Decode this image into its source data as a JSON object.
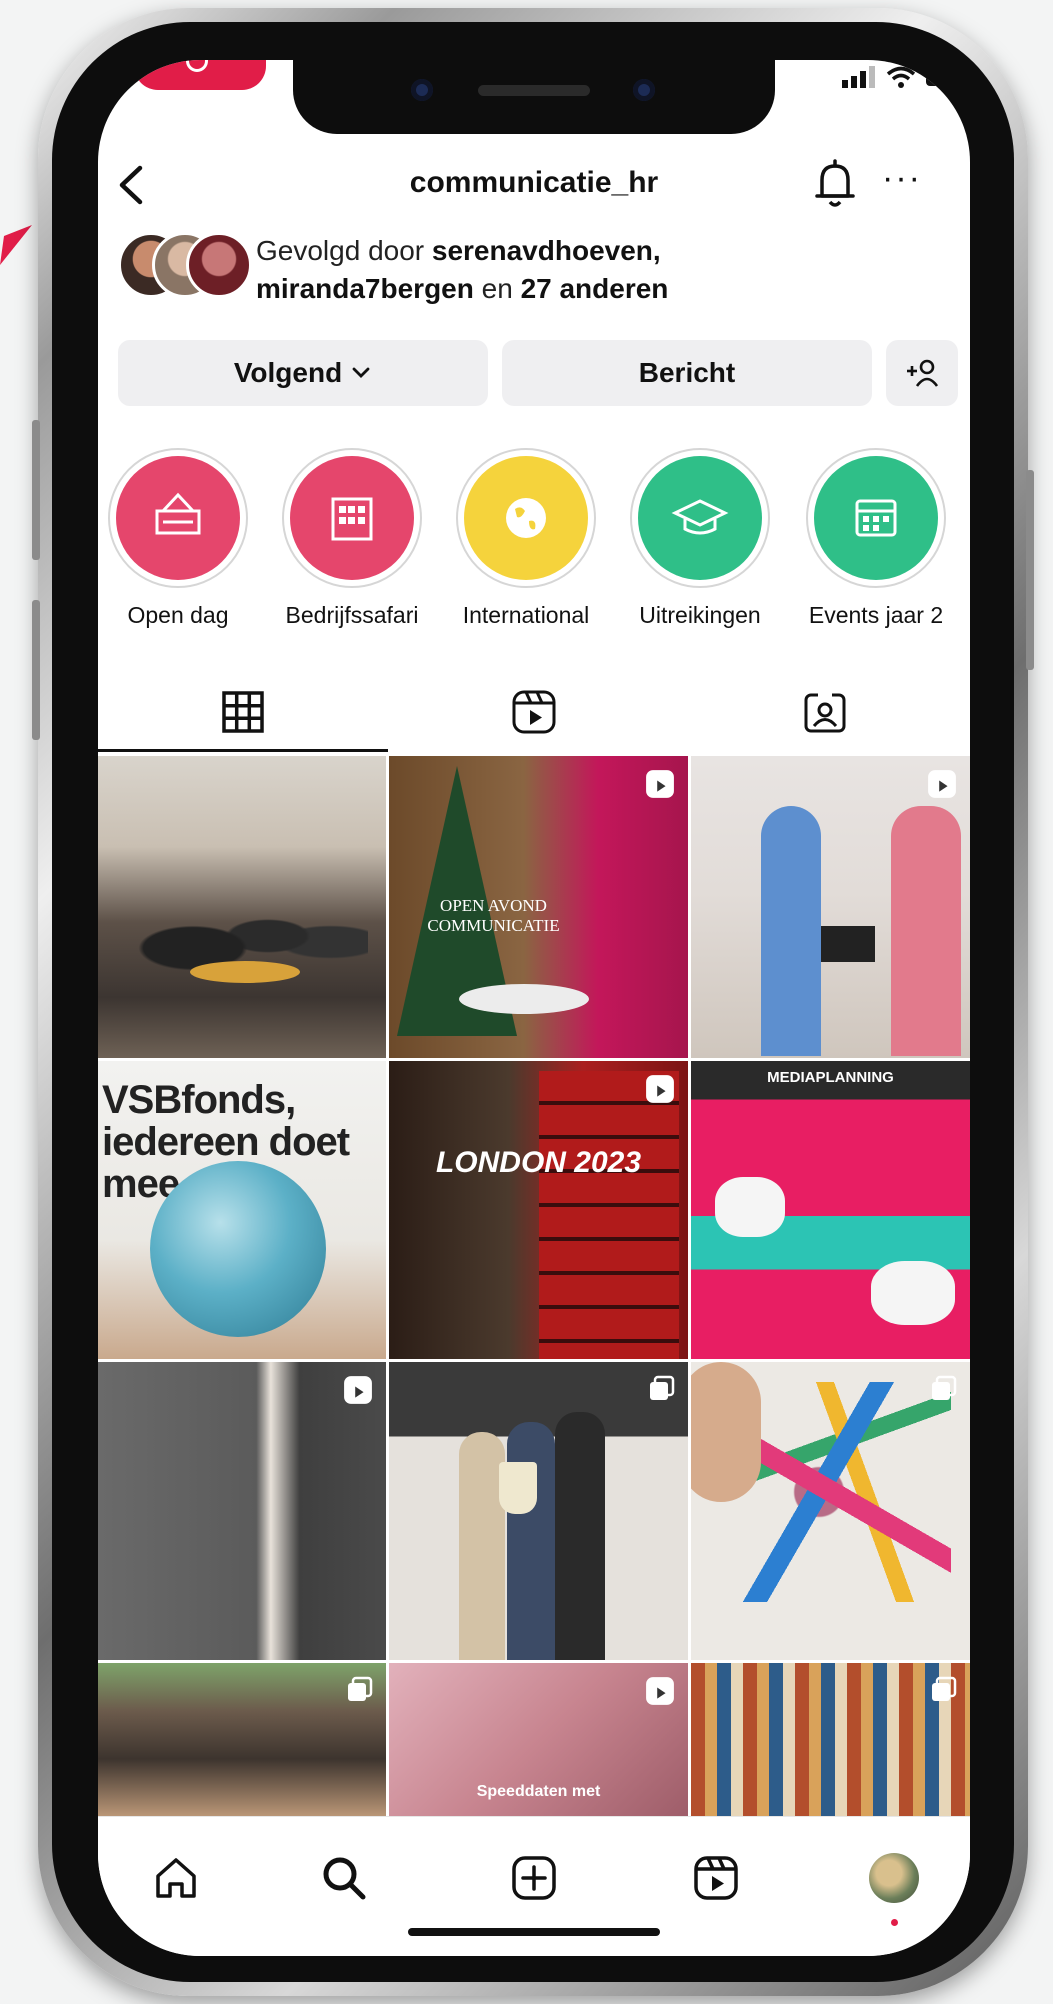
{
  "header": {
    "username": "communicatie_hr",
    "back_icon": "chevron-left-icon",
    "bell_icon": "bell-icon",
    "more_label": "···"
  },
  "followed_by": {
    "prefix": "Gevolgd door ",
    "user1": "serenavdhoeven,",
    "user2": "miranda7bergen",
    "middle": " en ",
    "others": "27 anderen"
  },
  "buttons": {
    "following_label": "Volgend",
    "message_label": "Bericht",
    "add_person_icon": "add-person-icon"
  },
  "highlights": [
    {
      "label": "Open dag",
      "color": "#e5466c",
      "icon": "open-sign-icon"
    },
    {
      "label": "Bedrijfssafari",
      "color": "#e5466c",
      "icon": "building-icon"
    },
    {
      "label": "International",
      "color": "#f5d33c",
      "icon": "globe-icon"
    },
    {
      "label": "Uitreikingen",
      "color": "#2fbf88",
      "icon": "graduation-cap-icon"
    },
    {
      "label": "Events jaar 2",
      "color": "#2fbf88",
      "icon": "calendar-icon"
    }
  ],
  "tabs": [
    {
      "name": "grid",
      "icon": "grid-icon",
      "active": true
    },
    {
      "name": "reels",
      "icon": "reels-icon",
      "active": false
    },
    {
      "name": "tagged",
      "icon": "tagged-person-icon",
      "active": false
    }
  ],
  "posts": [
    {
      "caption": "",
      "badge": ""
    },
    {
      "caption": "OPEN AVOND COMMUNICATIE",
      "badge": "reel"
    },
    {
      "caption": "",
      "badge": "reel"
    },
    {
      "caption": "VSBfonds, iedereen doet mee",
      "badge": ""
    },
    {
      "caption": "LONDON 2023",
      "badge": "reel"
    },
    {
      "caption": "MEDIAPLANNING",
      "badge": ""
    },
    {
      "caption": "",
      "badge": "reel"
    },
    {
      "caption": "",
      "badge": "multi"
    },
    {
      "caption": "",
      "badge": "multi"
    },
    {
      "caption": "",
      "badge": "multi"
    },
    {
      "caption": "Speeddaten met",
      "badge": "reel"
    },
    {
      "caption": "",
      "badge": "multi"
    }
  ],
  "bottom_nav": [
    {
      "name": "home",
      "icon": "home-icon"
    },
    {
      "name": "search",
      "icon": "search-icon"
    },
    {
      "name": "create",
      "icon": "plus-square-icon"
    },
    {
      "name": "reels",
      "icon": "reels-icon"
    },
    {
      "name": "profile",
      "icon": "profile-avatar-icon"
    }
  ],
  "colors": {
    "accent": "#e11d48",
    "button_bg": "#efeff1",
    "text": "#111111"
  }
}
